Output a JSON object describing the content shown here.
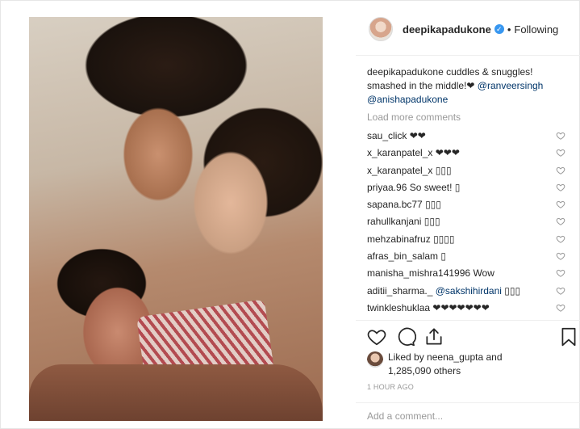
{
  "post": {
    "username": "deepikapadukone",
    "separator": "•",
    "follow_status": "Following",
    "caption": {
      "user": "deepikapadukone",
      "text": "cuddles & snuggles! smashed in the middle!❤",
      "mention1": "@ranveersingh",
      "mention2": "@anishapadukone"
    },
    "load_more": "Load more comments",
    "comments": [
      {
        "user": "sau_click",
        "text": "❤❤"
      },
      {
        "user": "x_karanpatel_x",
        "text": "❤❤❤"
      },
      {
        "user": "x_karanpatel_x",
        "text": "▯▯▯"
      },
      {
        "user": "priyaa.96",
        "text": "So sweet! ▯"
      },
      {
        "user": "sapana.bc77",
        "text": "▯▯▯"
      },
      {
        "user": "rahullkanjani",
        "text": "▯▯▯"
      },
      {
        "user": "mehzabinafruz",
        "text": "▯▯▯▯"
      },
      {
        "user": "afras_bin_salam",
        "text": "▯"
      },
      {
        "user": "manisha_mishra141996",
        "text": "Wow"
      },
      {
        "user": "aditii_sharma._",
        "mention": "@sakshihirdani",
        "text": "▯▯▯"
      },
      {
        "user": "twinkleshuklaa",
        "text": "❤❤❤❤❤❤❤"
      }
    ],
    "likes": {
      "prefix": "Liked by",
      "user": "neena_gupta",
      "and": "and",
      "count": "1,285,090 others"
    },
    "time": "1 HOUR AGO",
    "add_comment_placeholder": "Add a comment..."
  },
  "icons": {
    "like": "heart-icon",
    "comment": "comment-icon",
    "share": "share-icon",
    "save": "bookmark-icon",
    "verified": "verified-badge-icon"
  }
}
